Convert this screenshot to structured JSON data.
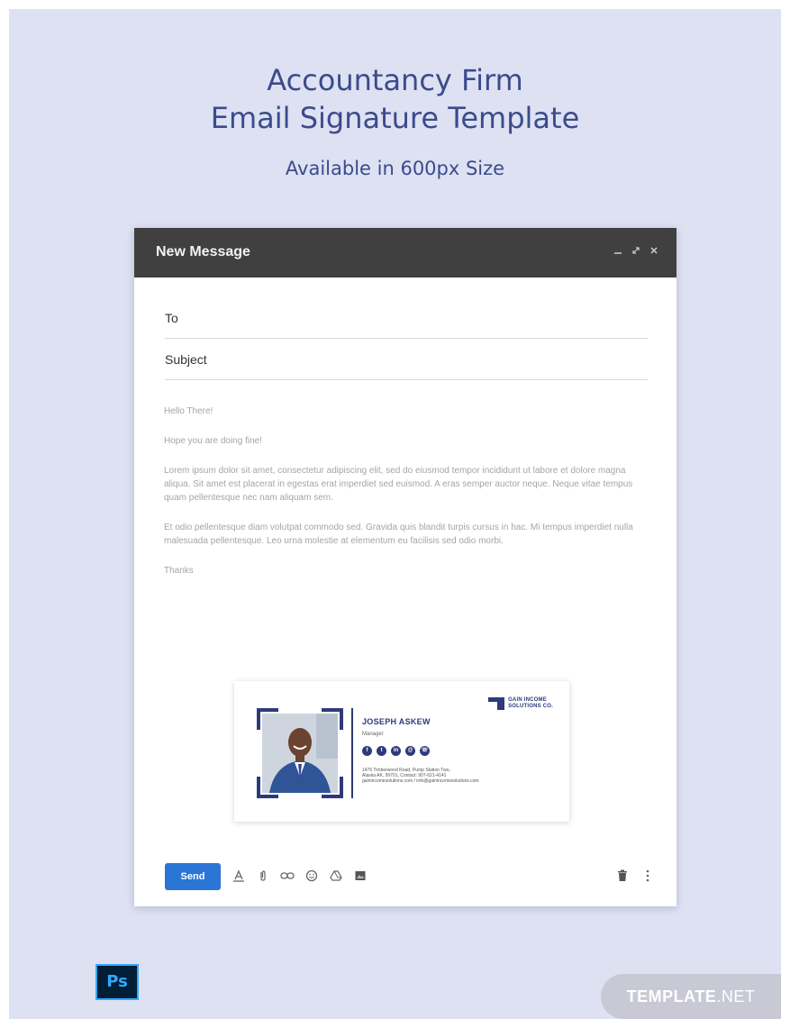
{
  "header": {
    "title_line1": "Accountancy Firm",
    "title_line2": "Email Signature Template",
    "subtitle": "Available in 600px Size"
  },
  "window": {
    "title": "New Message",
    "controls": [
      "minimize-icon",
      "expand-icon",
      "close-icon"
    ],
    "fields": {
      "to": "To",
      "subject": "Subject"
    },
    "body": {
      "greeting": "Hello There!",
      "line2": "Hope you are doing fine!",
      "paragraph1": "Lorem ipsum dolor sit amet, consectetur adipiscing elit, sed do eiusmod tempor incididunt ut labore et dolore magna aliqua. Sit amet est placerat in egestas erat imperdiet sed euismod. A eras semper auctor neque. Neque vitae tempus quam pellentesque nec nam aliquam sem.",
      "paragraph2": "Et odio pellentesque diam volutpat commodo sed. Gravida quis blandit turpis cursus in hac. Mi tempus imperdiet nulla malesuada pellentesque. Leo urna molestie at elementum eu facilisis sed odio morbi.",
      "closing": "Thanks"
    },
    "signature": {
      "company_line1": "GAIN INCOME",
      "company_line2": "SOLUTIONS CO.",
      "name": "JOSEPH ASKEW",
      "role": "Manager",
      "social_icons": [
        "facebook-icon",
        "twitter-icon",
        "linkedin-icon",
        "email-icon",
        "phone-icon"
      ],
      "address_line1": "1476 Timberwood Road, Pump Station Two,",
      "address_line2": "Alaska AK, 99701, Contact: 907-621-4141",
      "address_line3": "gainincomesolutions.com / info@gainincomesolutions.com"
    },
    "toolbar": {
      "send_label": "Send",
      "tools": [
        "format-text-icon",
        "attach-icon",
        "link-icon",
        "emoji-icon",
        "drive-icon",
        "photo-icon"
      ],
      "right_tools": [
        "trash-icon",
        "more-options-icon"
      ]
    }
  },
  "footer": {
    "ps_label": "Ps",
    "brand_main": "TEMPLATE",
    "brand_suffix": ".NET"
  },
  "colors": {
    "background": "#dde1f2",
    "title": "#3b4b8c",
    "header_bar": "#404040",
    "send_button": "#2a75d6",
    "signature_accent": "#2e3a7a"
  }
}
